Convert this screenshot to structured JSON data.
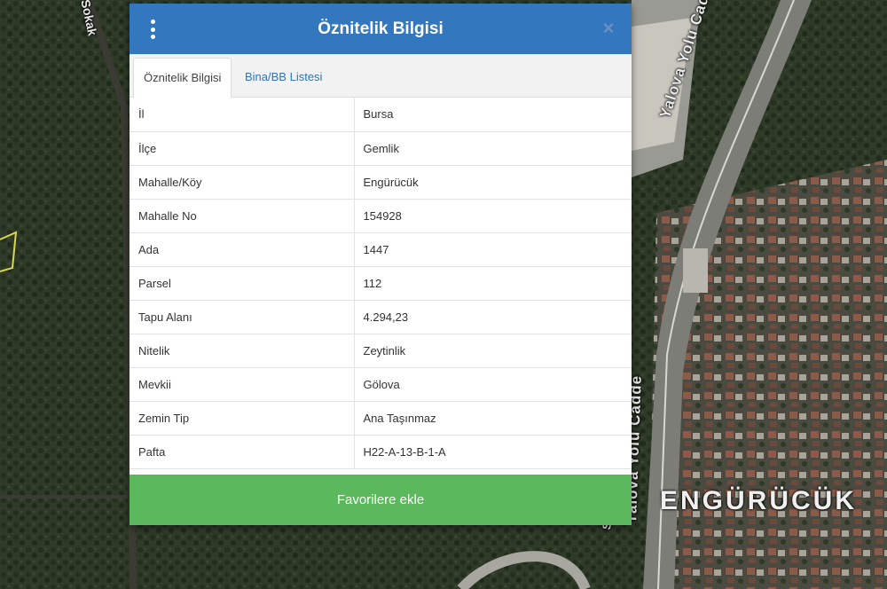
{
  "map": {
    "labels": {
      "yalova_yolu_top": "Yalova Yolu Cadde",
      "yalova_yolu_bottom": "Yalova Yolu Cadde",
      "sokak_top": "Sokak",
      "sokak_bottom": "Sokak",
      "neighborhood": "ENGÜRÜCÜK"
    }
  },
  "dialog": {
    "title": "Öznitelik Bilgisi",
    "close_symbol": "×",
    "tabs": [
      {
        "label": "Öznitelik Bilgisi",
        "active": true
      },
      {
        "label": "Bina/BB Listesi",
        "active": false
      }
    ],
    "rows": [
      {
        "key": "İl",
        "value": "Bursa"
      },
      {
        "key": "İlçe",
        "value": "Gemlik"
      },
      {
        "key": "Mahalle/Köy",
        "value": "Engürücük"
      },
      {
        "key": "Mahalle No",
        "value": "154928"
      },
      {
        "key": "Ada",
        "value": "1447"
      },
      {
        "key": "Parsel",
        "value": "112"
      },
      {
        "key": "Tapu Alanı",
        "value": "4.294,23"
      },
      {
        "key": "Nitelik",
        "value": "Zeytinlik"
      },
      {
        "key": "Mevkii",
        "value": "Gölova"
      },
      {
        "key": "Zemin Tip",
        "value": "Ana Taşınmaz"
      },
      {
        "key": "Pafta",
        "value": "H22-A-13-B-1-A"
      }
    ],
    "favorite_button": "Favorilere ekle"
  },
  "colors": {
    "header": "#3378be",
    "favorite_button": "#5cb85c",
    "tab_link": "#2f74b8"
  },
  "icons": {
    "menu": "kebab-menu-icon",
    "close": "close-icon"
  }
}
